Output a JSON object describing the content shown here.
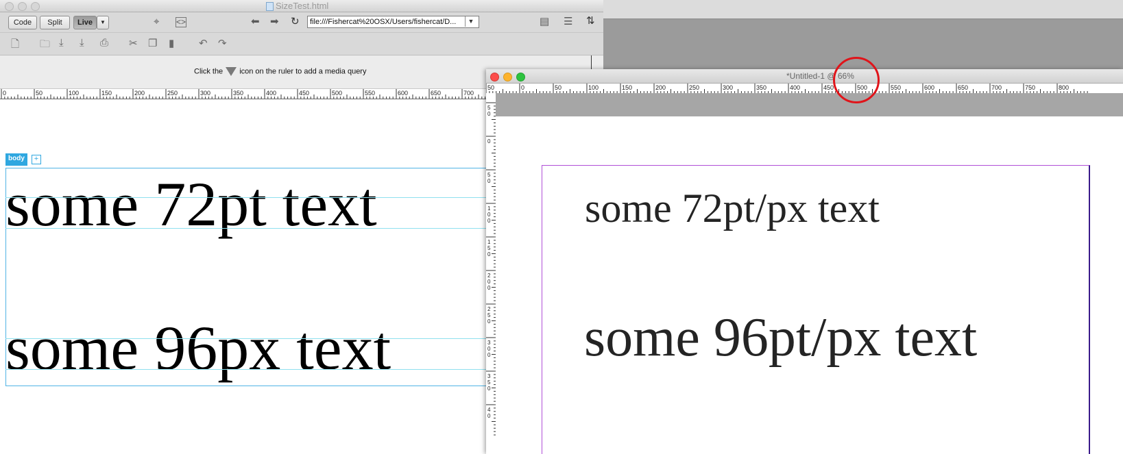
{
  "left_window": {
    "title": "SizeTest.html",
    "view_buttons": {
      "code": "Code",
      "split": "Split",
      "live": "Live"
    },
    "url": "file:///Fishercat%20OSX/Users/fishercat/D...",
    "media_query_hint_prefix": "Click the",
    "media_query_hint_suffix": "icon on the ruler to add a media query",
    "ruler_labels": [
      "0",
      "50",
      "100",
      "150",
      "200",
      "250",
      "300",
      "350",
      "400",
      "450",
      "500",
      "550",
      "600",
      "650",
      "700"
    ],
    "body_tag": "body",
    "body_tag_plus": "+",
    "text_72": "some 72pt text",
    "text_96": "some 96px text"
  },
  "right_window": {
    "title": "*Untitled-1 @ 66%",
    "ruler_labels": [
      "50",
      "0",
      "50",
      "100",
      "150",
      "200",
      "250",
      "300",
      "350",
      "400",
      "450",
      "500",
      "550",
      "600",
      "650",
      "700",
      "750",
      "800"
    ],
    "vruler_labels": [
      "5 0",
      "0",
      "5 0",
      "1 0 0",
      "1 5 0",
      "2 0 0",
      "2 5 0",
      "3 0 0",
      "3 5 0",
      "4 0"
    ],
    "text_72": "some 72pt/px text",
    "text_96": "some 96pt/px text"
  },
  "colors": {
    "guide": "#8fe0ef",
    "body_outline": "#4fb3e5",
    "artboard": "#b04fd8",
    "highlight_circle": "#e0141a"
  }
}
